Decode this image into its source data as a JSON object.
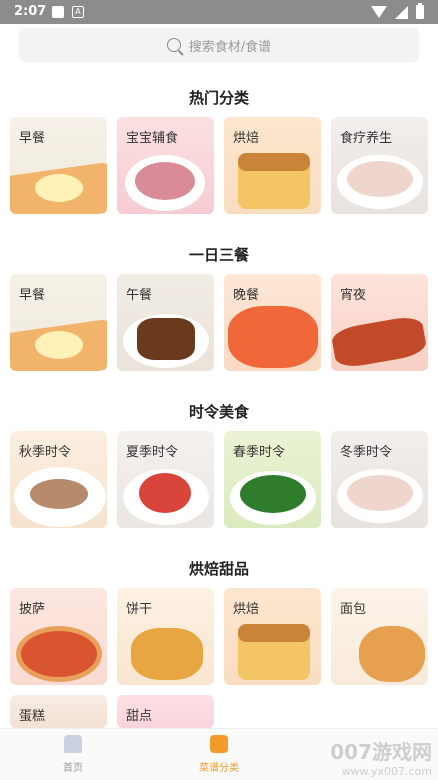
{
  "status_bar": {
    "time": "2:07"
  },
  "search": {
    "placeholder": "搜索食材/食谱"
  },
  "sections": [
    {
      "title": "热门分类",
      "items": [
        "早餐",
        "宝宝辅食",
        "烘焙",
        "食疗养生"
      ]
    },
    {
      "title": "一日三餐",
      "items": [
        "早餐",
        "午餐",
        "晚餐",
        "宵夜"
      ]
    },
    {
      "title": "时令美食",
      "items": [
        "秋季时令",
        "夏季时令",
        "春季时令",
        "冬季时令"
      ]
    },
    {
      "title": "烘焙甜品",
      "items": [
        "披萨",
        "饼干",
        "烘焙",
        "面包",
        "蛋糕",
        "甜点"
      ]
    }
  ],
  "tabbar": {
    "home": "首页",
    "recipes": "菜谱分类"
  },
  "watermark": {
    "main": "007游戏网",
    "sub": "www.yx007.com"
  },
  "colors": {
    "accent": "#f39a2b",
    "inactive": "#9a9a9a"
  }
}
